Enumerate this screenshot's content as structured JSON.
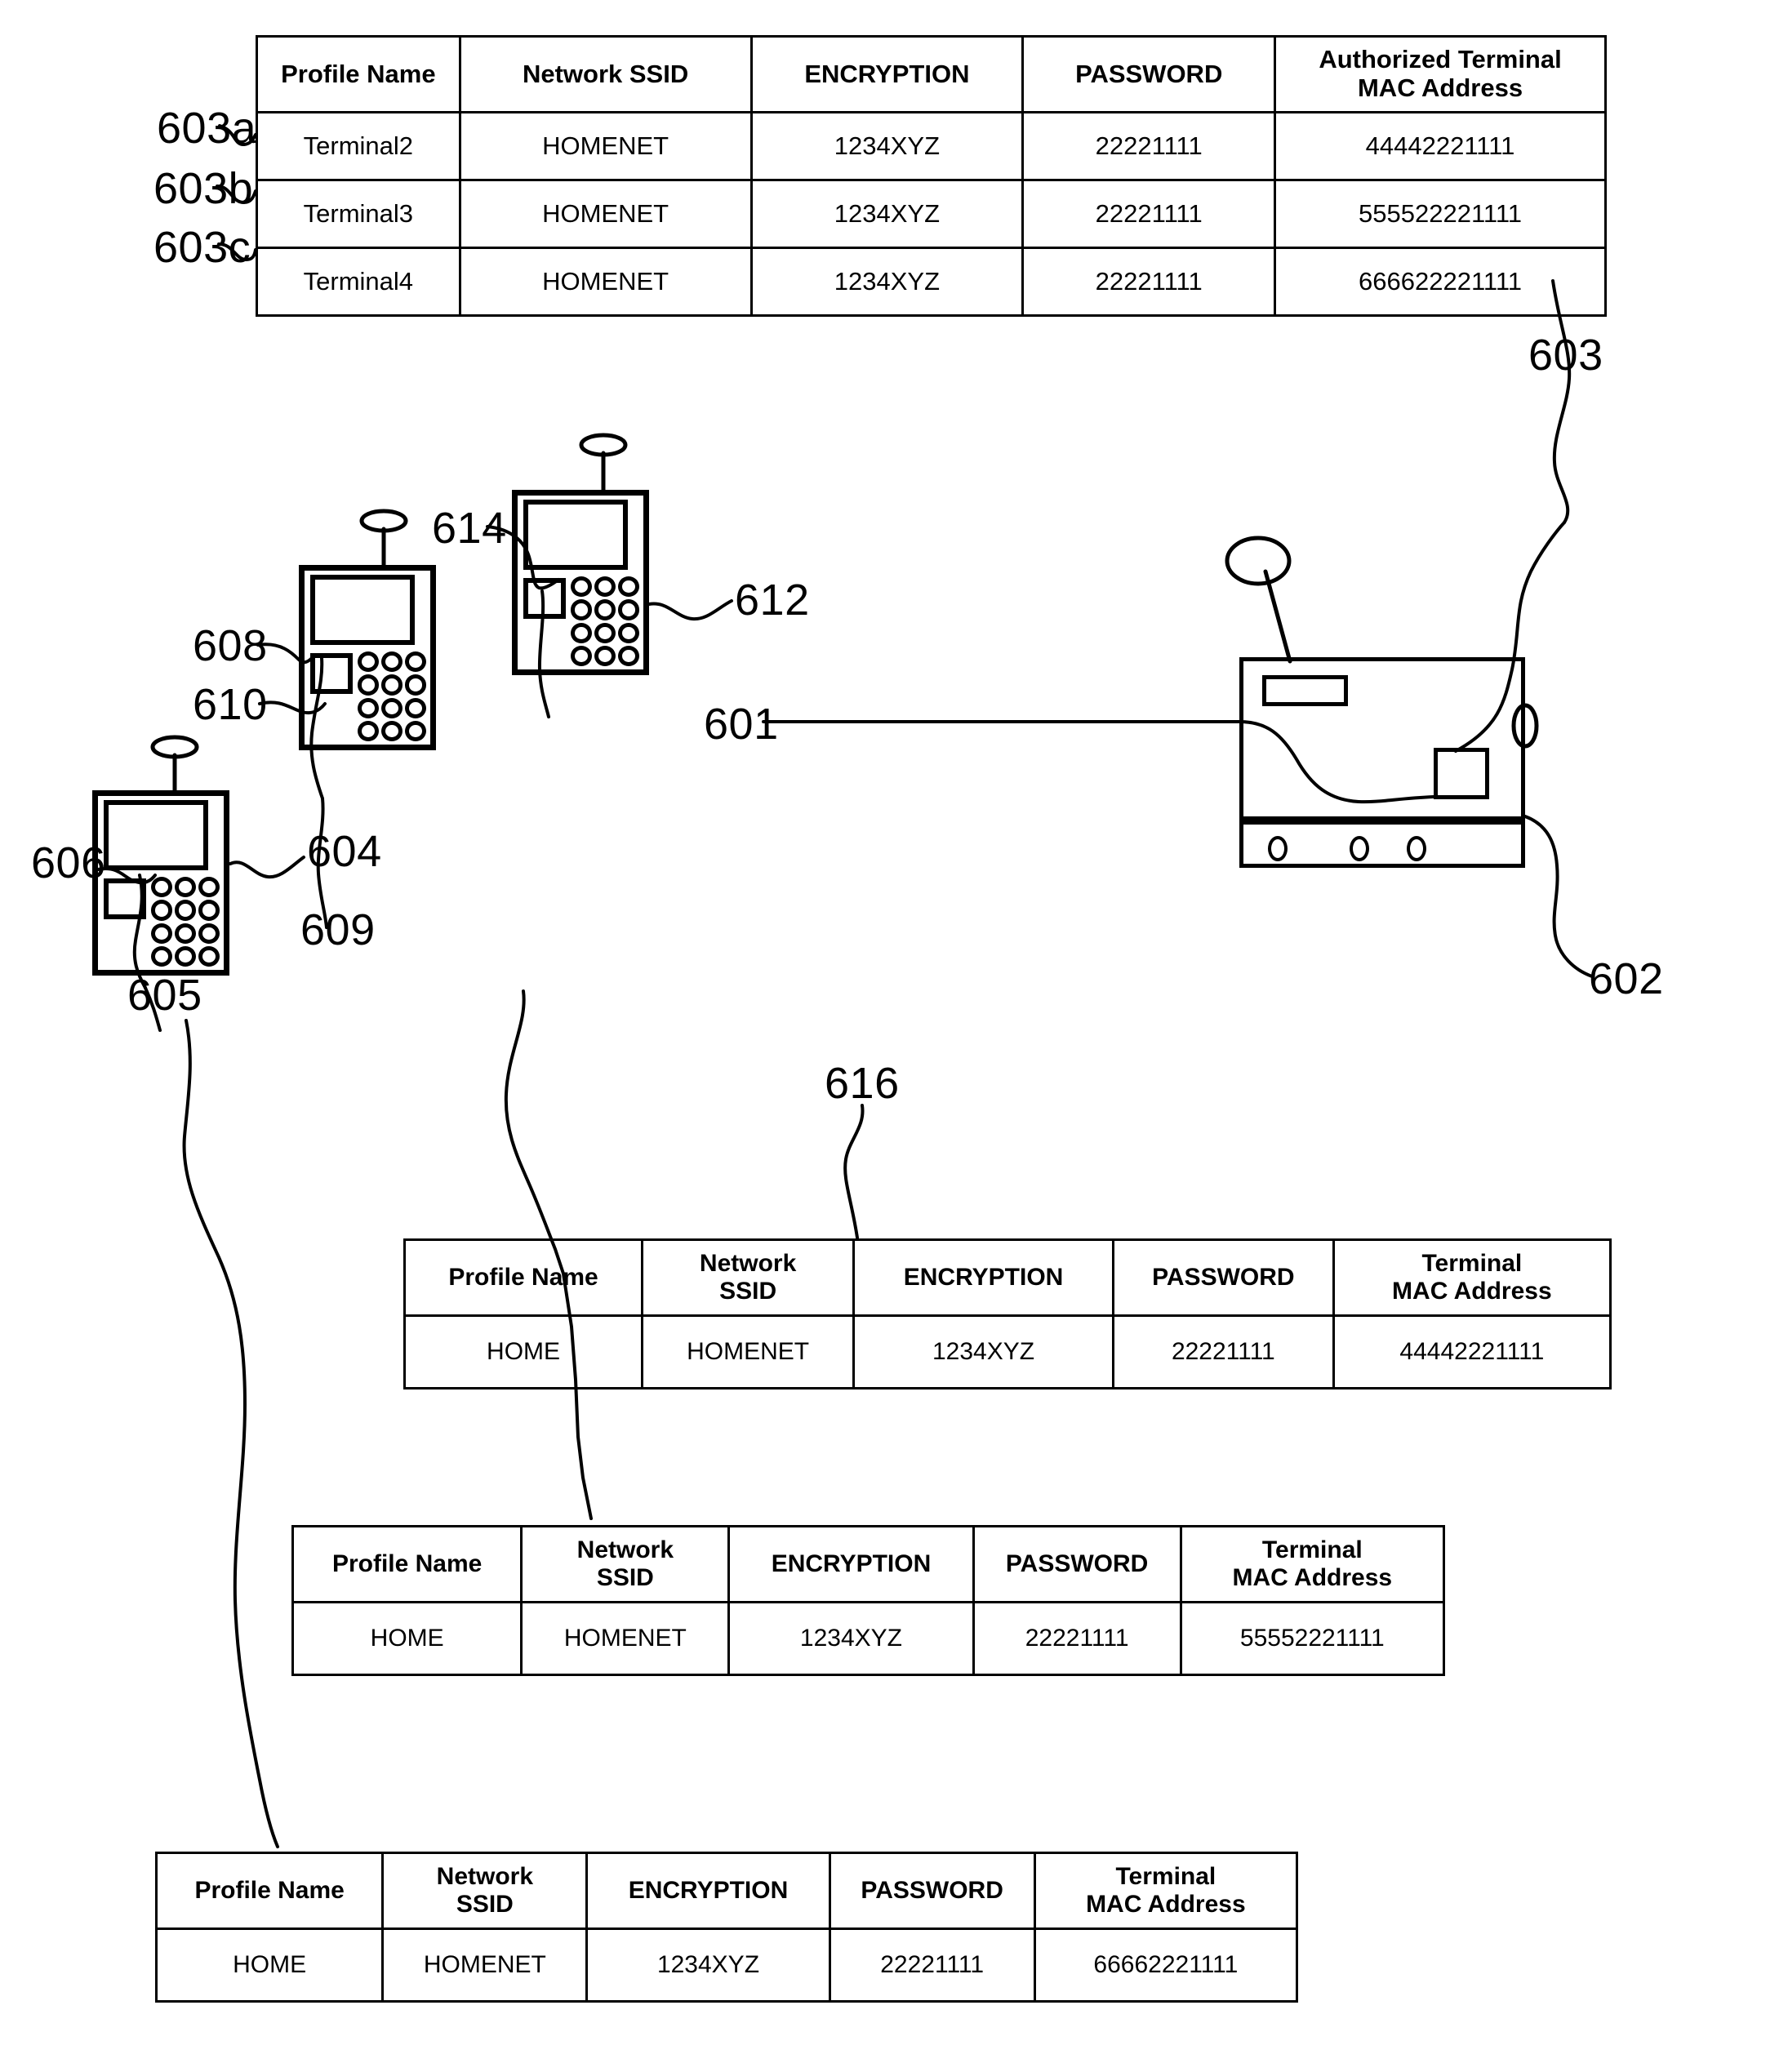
{
  "figure": {
    "title": "Wireless network profile distribution diagram",
    "refs": {
      "r601": "601",
      "r602": "602",
      "r603": "603",
      "r603a": "603a",
      "r603b": "603b",
      "r603c": "603c",
      "r604": "604",
      "r605": "605",
      "r606": "606",
      "r608": "608",
      "r609": "609",
      "r610": "610",
      "r612": "612",
      "r614": "614",
      "r616": "616"
    }
  },
  "router_table": {
    "name": "authorized-terminal-profile-table",
    "headers": [
      "Profile Name",
      "Network SSID",
      "ENCRYPTION",
      "PASSWORD",
      "Authorized Terminal\nMAC Address"
    ],
    "headers_lines": {
      "h0": "Profile Name",
      "h1": "Network SSID",
      "h2": "ENCRYPTION",
      "h3": "PASSWORD",
      "h4a": "Authorized Terminal",
      "h4b": "MAC Address"
    },
    "rows": [
      {
        "ref": "603a",
        "profile_name": "Terminal2",
        "network_ssid": "HOMENET",
        "encryption": "1234XYZ",
        "password": "22221111",
        "mac_address": "44442221111"
      },
      {
        "ref": "603b",
        "profile_name": "Terminal3",
        "network_ssid": "HOMENET",
        "encryption": "1234XYZ",
        "password": "22221111",
        "mac_address": "555522221111"
      },
      {
        "ref": "603c",
        "profile_name": "Terminal4",
        "network_ssid": "HOMENET",
        "encryption": "1234XYZ",
        "password": "22221111",
        "mac_address": "666622221111"
      }
    ]
  },
  "terminal_tables": [
    {
      "ref": "616",
      "name": "terminal-612-profile-table",
      "headers_lines": {
        "h0": "Profile Name",
        "h1a": "Network",
        "h1b": "SSID",
        "h2": "ENCRYPTION",
        "h3": "PASSWORD",
        "h4a": "Terminal",
        "h4b": "MAC Address"
      },
      "row": {
        "profile_name": "HOME",
        "network_ssid": "HOMENET",
        "encryption": "1234XYZ",
        "password": "22221111",
        "mac_address": "44442221111"
      }
    },
    {
      "ref": "609",
      "name": "terminal-608-profile-table",
      "headers_lines": {
        "h0": "Profile Name",
        "h1a": "Network",
        "h1b": "SSID",
        "h2": "ENCRYPTION",
        "h3": "PASSWORD",
        "h4a": "Terminal",
        "h4b": "MAC Address"
      },
      "row": {
        "profile_name": "HOME",
        "network_ssid": "HOMENET",
        "encryption": "1234XYZ",
        "password": "22221111",
        "mac_address": "55552221111"
      }
    },
    {
      "ref": "605",
      "name": "terminal-604-profile-table",
      "headers_lines": {
        "h0": "Profile Name",
        "h1a": "Network",
        "h1b": "SSID",
        "h2": "ENCRYPTION",
        "h3": "PASSWORD",
        "h4a": "Terminal",
        "h4b": "MAC Address"
      },
      "row": {
        "profile_name": "HOME",
        "network_ssid": "HOMENET",
        "encryption": "1234XYZ",
        "password": "22221111",
        "mac_address": "66662221111"
      }
    }
  ],
  "colors": {
    "ink": "#000000",
    "paper": "#ffffff"
  }
}
